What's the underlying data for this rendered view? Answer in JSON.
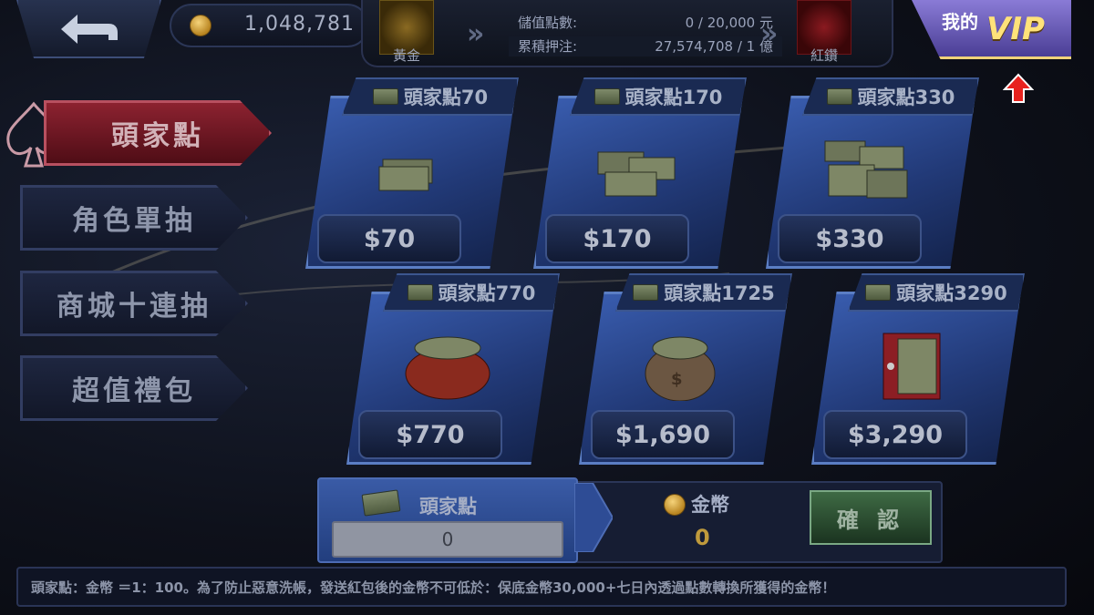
{
  "header": {
    "coin_balance": "1,048,781",
    "vip_progress": {
      "current_tier": "黃金",
      "next_tier": "紅鑽",
      "stored_points_label": "儲值點數:",
      "stored_points_value": "0 / 20,000 元",
      "bets_label": "累積押注:",
      "bets_value": "27,574,708 / 1 億"
    },
    "vip_button": {
      "my_label": "我的",
      "vip_label": "VIP"
    }
  },
  "sidebar": {
    "items": [
      {
        "label": "頭家點",
        "active": true
      },
      {
        "label": "角色單抽",
        "active": false
      },
      {
        "label": "商城十連抽",
        "active": false
      },
      {
        "label": "超值禮包",
        "active": false
      }
    ]
  },
  "products": [
    {
      "title": "頭家點70",
      "price": "$70",
      "art": "small-cash-stack"
    },
    {
      "title": "頭家點170",
      "price": "$170",
      "art": "cash-stacks"
    },
    {
      "title": "頭家點330",
      "price": "$330",
      "art": "large-cash-stacks"
    },
    {
      "title": "頭家點770",
      "price": "$770",
      "art": "red-money-bag"
    },
    {
      "title": "頭家點1725",
      "price": "$1,690",
      "art": "brown-money-bag"
    },
    {
      "title": "頭家點3290",
      "price": "$3,290",
      "art": "red-safe"
    }
  ],
  "exchange": {
    "from_label": "頭家點",
    "from_value": "0",
    "to_label": "金幣",
    "to_value": "0",
    "confirm_label": "確 認"
  },
  "notice": "頭家點：金幣 ＝1：100。為了防止惡意洗帳，發送紅包後的金幣不可低於：保底金幣30,000+七日內透過點數轉換所獲得的金幣！",
  "colors": {
    "accent_gold": "#ffe27a",
    "vip_purple": "#6a5bc0",
    "card_blue": "#2e4c95",
    "active_red": "#8c2230",
    "confirm_green": "#3e6a44"
  }
}
